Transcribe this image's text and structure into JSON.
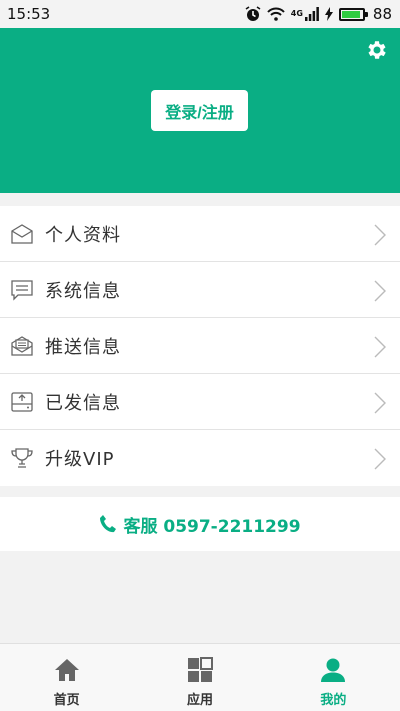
{
  "status_bar": {
    "time": "15:53",
    "network": "4G",
    "battery_percent": "88",
    "battery_level": 0.88
  },
  "header": {
    "login_label": "登录/注册",
    "settings_icon": "gear-icon"
  },
  "menu": {
    "items": [
      {
        "label": "个人资料",
        "icon": "profile-card-icon"
      },
      {
        "label": "系统信息",
        "icon": "message-icon"
      },
      {
        "label": "推送信息",
        "icon": "mail-icon"
      },
      {
        "label": "已发信息",
        "icon": "outbox-icon"
      },
      {
        "label": "升级VIP",
        "icon": "trophy-icon"
      }
    ]
  },
  "service": {
    "label": "客服 0597-2211299"
  },
  "tabbar": {
    "tabs": [
      {
        "label": "首页",
        "icon": "home-icon"
      },
      {
        "label": "应用",
        "icon": "apps-grid-icon"
      },
      {
        "label": "我的",
        "icon": "user-icon",
        "active": true
      }
    ]
  },
  "colors": {
    "accent": "#0aae84",
    "battery": "#2ecc40"
  }
}
